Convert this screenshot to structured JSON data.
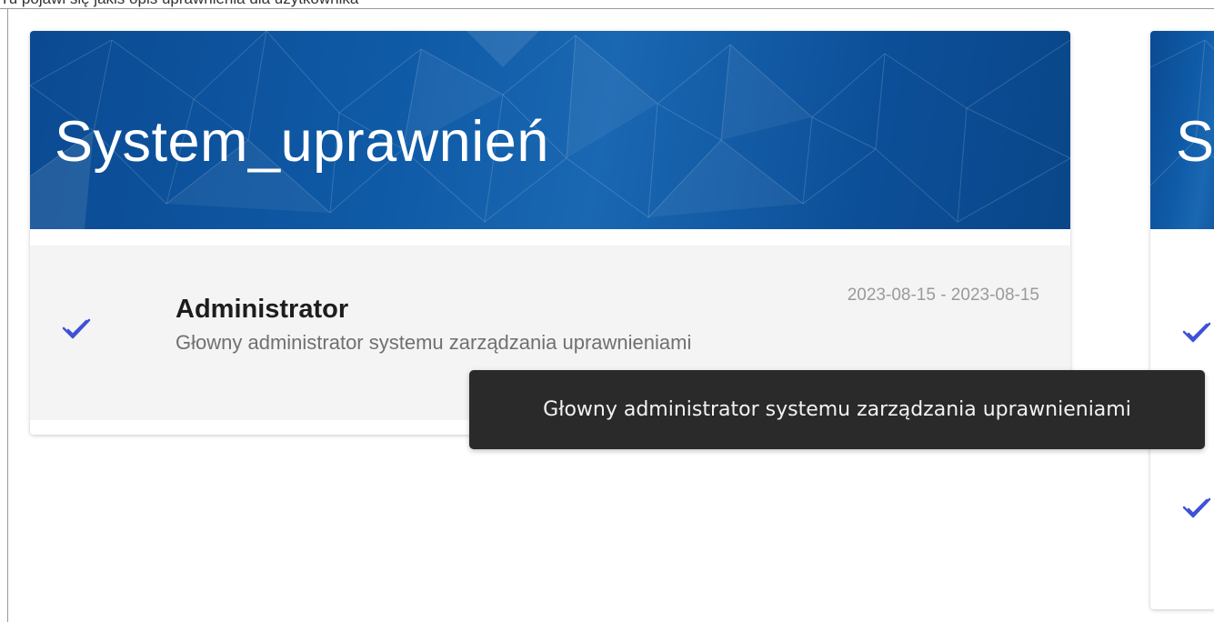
{
  "top_strip_text": "Tu pojawi się jakiś opis uprawnienia dla użytkownika",
  "cards": [
    {
      "title": "System_uprawnień",
      "role": {
        "name": "Administrator",
        "description": "Głowny administrator systemu zarządzania uprawnieniami",
        "dates": "2023-08-15 - 2023-08-15",
        "icon": "double-check-icon"
      }
    },
    {
      "title": "S"
    }
  ],
  "tooltip": {
    "text": "Głowny administrator systemu zarządzania uprawnieniami"
  },
  "colors": {
    "banner": "#0f5aa6",
    "check": "#3f51d6",
    "tooltip_bg": "#2a2a2a",
    "item_bg": "#f4f4f4"
  }
}
